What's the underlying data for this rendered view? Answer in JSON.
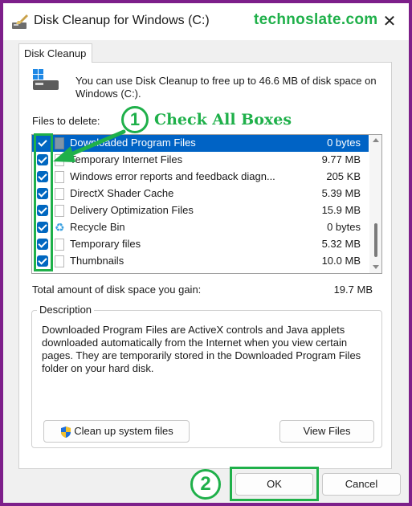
{
  "window": {
    "title": "Disk Cleanup for Windows (C:)",
    "close_symbol": "✕"
  },
  "watermark": "technoslate.com",
  "tab": {
    "label": "Disk Cleanup"
  },
  "intro": "You can use Disk Cleanup to free up to 46.6 MB of disk space on Windows (C:).",
  "files_label": "Files to delete:",
  "annotations": {
    "step1_number": "1",
    "step1_text": "Check All Boxes",
    "step2_number": "2",
    "color": "#1fb04a"
  },
  "files": [
    {
      "name": "Downloaded Program Files",
      "size": "0 bytes",
      "checked": true,
      "selected": true,
      "icon": "folder-icon"
    },
    {
      "name": "Temporary Internet Files",
      "size": "9.77 MB",
      "checked": true,
      "selected": false,
      "icon": "lock-file-icon"
    },
    {
      "name": "Windows error reports and feedback diagn...",
      "size": "205 KB",
      "checked": true,
      "selected": false,
      "icon": "file-icon"
    },
    {
      "name": "DirectX Shader Cache",
      "size": "5.39 MB",
      "checked": true,
      "selected": false,
      "icon": "file-icon"
    },
    {
      "name": "Delivery Optimization Files",
      "size": "15.9 MB",
      "checked": true,
      "selected": false,
      "icon": "file-icon"
    },
    {
      "name": "Recycle Bin",
      "size": "0 bytes",
      "checked": true,
      "selected": false,
      "icon": "recycle-bin-icon"
    },
    {
      "name": "Temporary files",
      "size": "5.32 MB",
      "checked": true,
      "selected": false,
      "icon": "file-icon"
    },
    {
      "name": "Thumbnails",
      "size": "10.0 MB",
      "checked": true,
      "selected": false,
      "icon": "file-icon"
    }
  ],
  "total": {
    "label": "Total amount of disk space you gain:",
    "value": "19.7 MB"
  },
  "description": {
    "title": "Description",
    "text": "Downloaded Program Files are ActiveX controls and Java applets downloaded automatically from the Internet when you view certain pages. They are temporarily stored in the Downloaded Program Files folder on your hard disk."
  },
  "buttons": {
    "cleanup": "Clean up system files",
    "view_files": "View Files",
    "ok": "OK",
    "cancel": "Cancel"
  },
  "colors": {
    "accent": "#0067c0",
    "selection": "#0063c5",
    "frame": "#7d1f8a"
  }
}
